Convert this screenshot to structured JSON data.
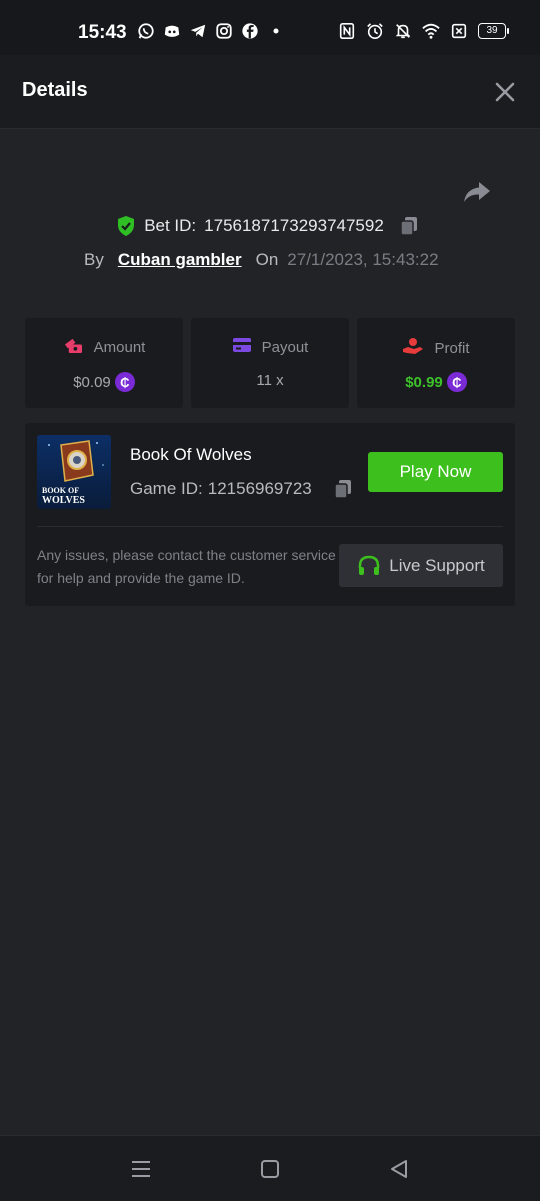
{
  "status_bar": {
    "time": "15:43",
    "battery": "39",
    "left_icons": [
      "whatsapp-icon",
      "discord-icon",
      "telegram-icon",
      "instagram-icon",
      "facebook-icon",
      "dot-icon"
    ],
    "right_icons": [
      "nfc-icon",
      "alarm-icon",
      "bell-off-icon",
      "wifi-icon",
      "sim-off-icon",
      "battery-icon"
    ]
  },
  "header": {
    "title": "Details",
    "close_icon": "close-icon"
  },
  "bet": {
    "id_label": "Bet ID:",
    "id_value": "1756187173293747592",
    "by_label": "By",
    "user": "Cuban gambler",
    "on_label": "On",
    "date": "27/1/2023, 15:43:22"
  },
  "stats": {
    "amount": {
      "label": "Amount",
      "value": "$0.09"
    },
    "payout": {
      "label": "Payout",
      "value": "11 x"
    },
    "profit": {
      "label": "Profit",
      "value": "$0.99"
    },
    "coin_symbol": "₵"
  },
  "game": {
    "name": "Book Of Wolves",
    "id_label": "Game ID:",
    "id_value": "12156969723",
    "thumb_text_1": "BOOK OF",
    "thumb_text_2": "WOLVES",
    "play_label": "Play Now",
    "help_text": "Any issues, please contact the customer service for help and provide the game ID.",
    "support_label": "Live Support"
  },
  "colors": {
    "accent_green": "#3dbf1d",
    "coin_purple": "#7a2bd6",
    "background": "#222327",
    "card": "#1a1b1e"
  }
}
